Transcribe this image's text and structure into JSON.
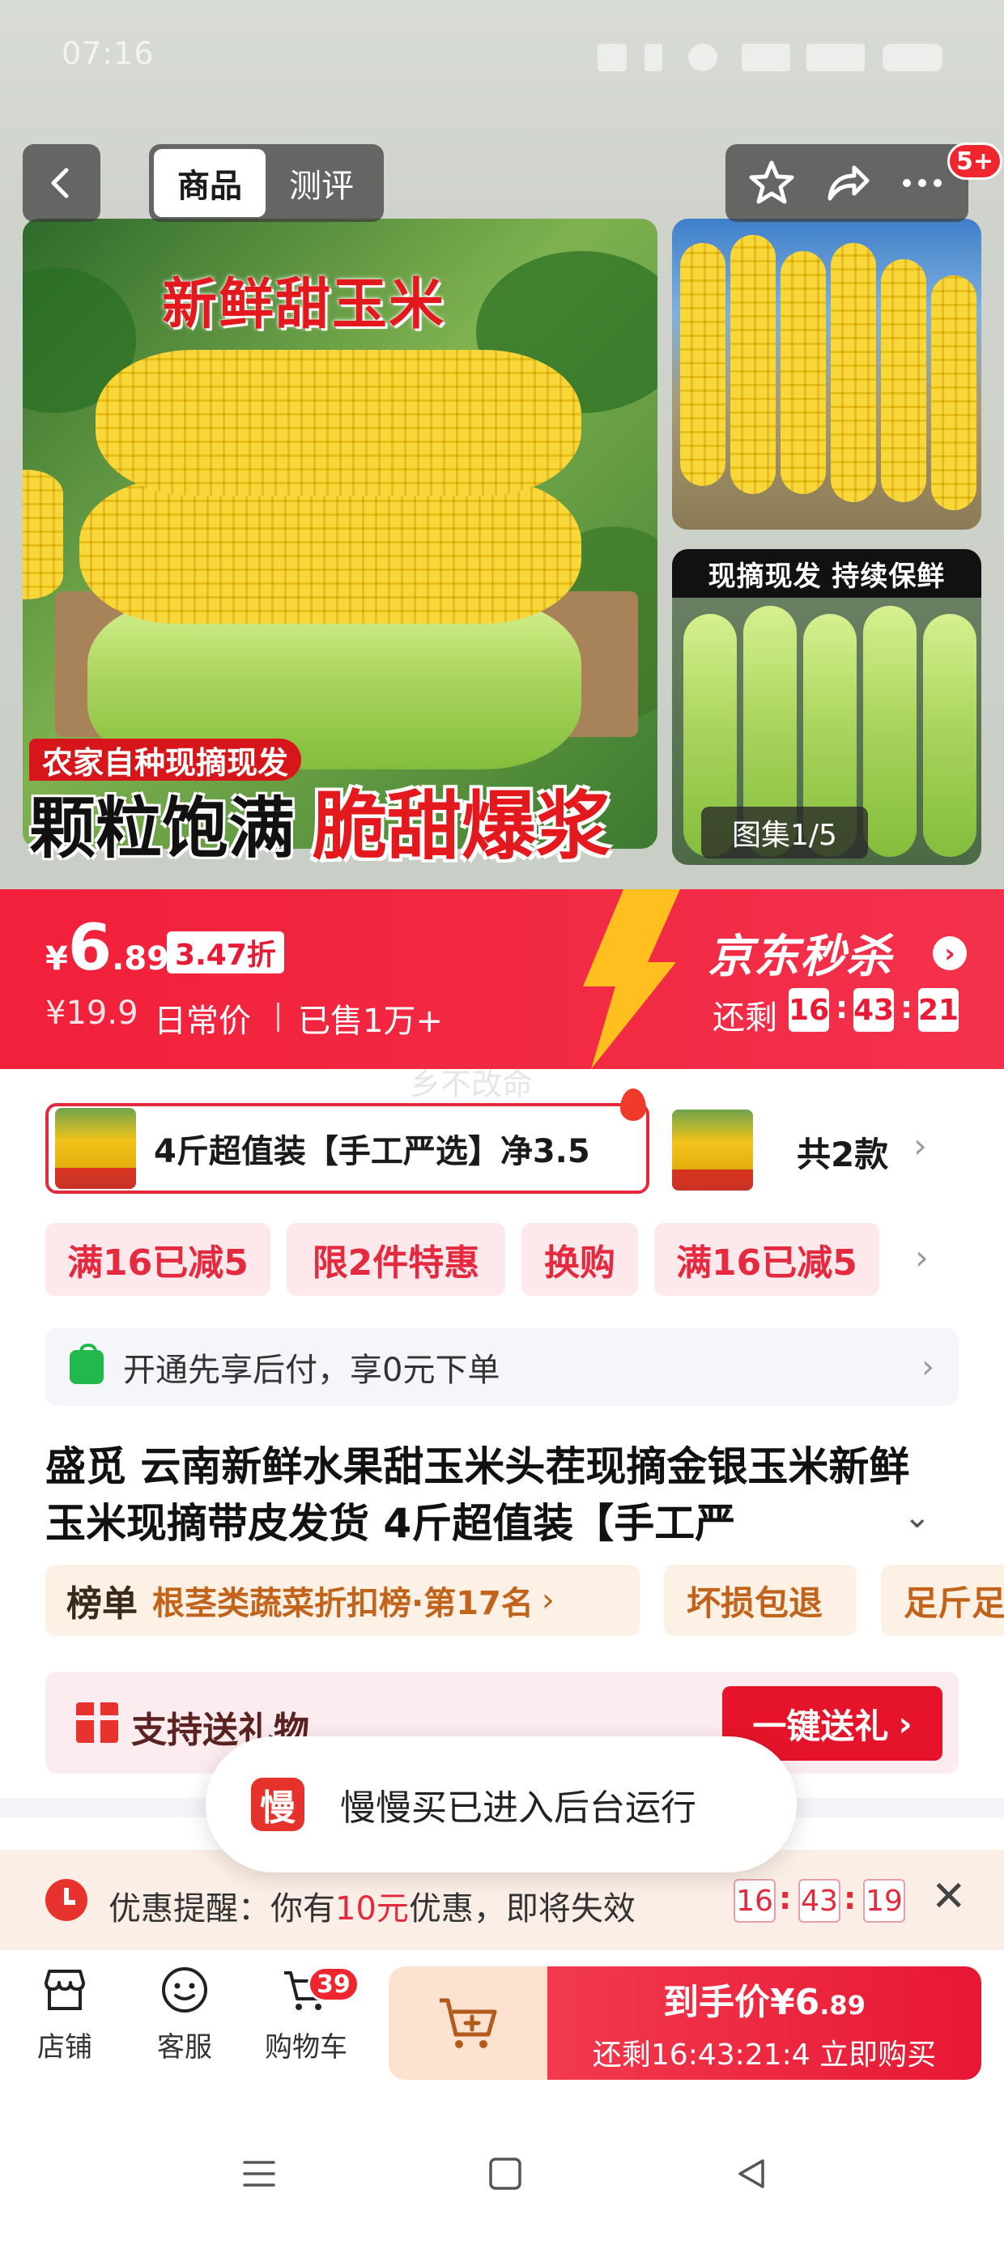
{
  "status_bar": {
    "time": "07:16"
  },
  "nav": {
    "tabs": [
      "商品",
      "测评"
    ],
    "active_tab": 0,
    "more_badge": "5+"
  },
  "gallery": {
    "main_title": "新鲜甜玉米",
    "main_tag": "农家自种现摘现发",
    "main_slogan_a": "颗粒饱满",
    "main_slogan_b": "脆甜爆浆",
    "side_banner": "现摘现发 持续保鲜",
    "counter": "图集1/5"
  },
  "price": {
    "currency": "¥",
    "integer": "6",
    "decimal": ".89",
    "discount": "3.47折",
    "original": "¥19.9",
    "daily_label": "日常价",
    "sold": "已售1万+",
    "flash_title": "京东秒杀",
    "remaining_label": "还剩",
    "countdown": [
      "16",
      "43",
      "21"
    ]
  },
  "watermark": "乡不改命",
  "variants": {
    "selected_label": "4斤超值装【手工严选】净3.5",
    "count_label": "共2款"
  },
  "promos": [
    "满16已减5",
    "限2件特惠",
    "换购",
    "满16已减5"
  ],
  "pay_later": {
    "text": "开通先享后付，享0元下单"
  },
  "product": {
    "title": "盛觅 云南新鲜水果甜玉米头茬现摘金银玉米新鲜玉米现摘带皮发货 4斤超值装【手工严"
  },
  "tags": {
    "ranking_label": "榜单",
    "ranking_text": "根茎类蔬菜折扣榜·第17名",
    "service_1": "坏损包退",
    "service_2": "足斤足"
  },
  "gift": {
    "text": "支持送礼物",
    "button": "一键送礼"
  },
  "toast": {
    "icon_char": "慢",
    "text": "慢慢买已进入后台运行"
  },
  "reminder": {
    "prefix": "优惠提醒：你有",
    "amount": "10元",
    "suffix": "优惠，即将失效",
    "countdown": [
      "16",
      "43",
      "19"
    ]
  },
  "bottom_bar": {
    "store": "店铺",
    "service": "客服",
    "cart": "购物车",
    "cart_badge": "39",
    "buy_price_prefix": "到手价¥6",
    "buy_price_decimal": ".89",
    "buy_sub": "还剩16:43:21:4 立即购买"
  },
  "colors": {
    "accent": "#f2203a",
    "promo_bg": "#fde9ec",
    "tag_text": "#c1631a"
  }
}
